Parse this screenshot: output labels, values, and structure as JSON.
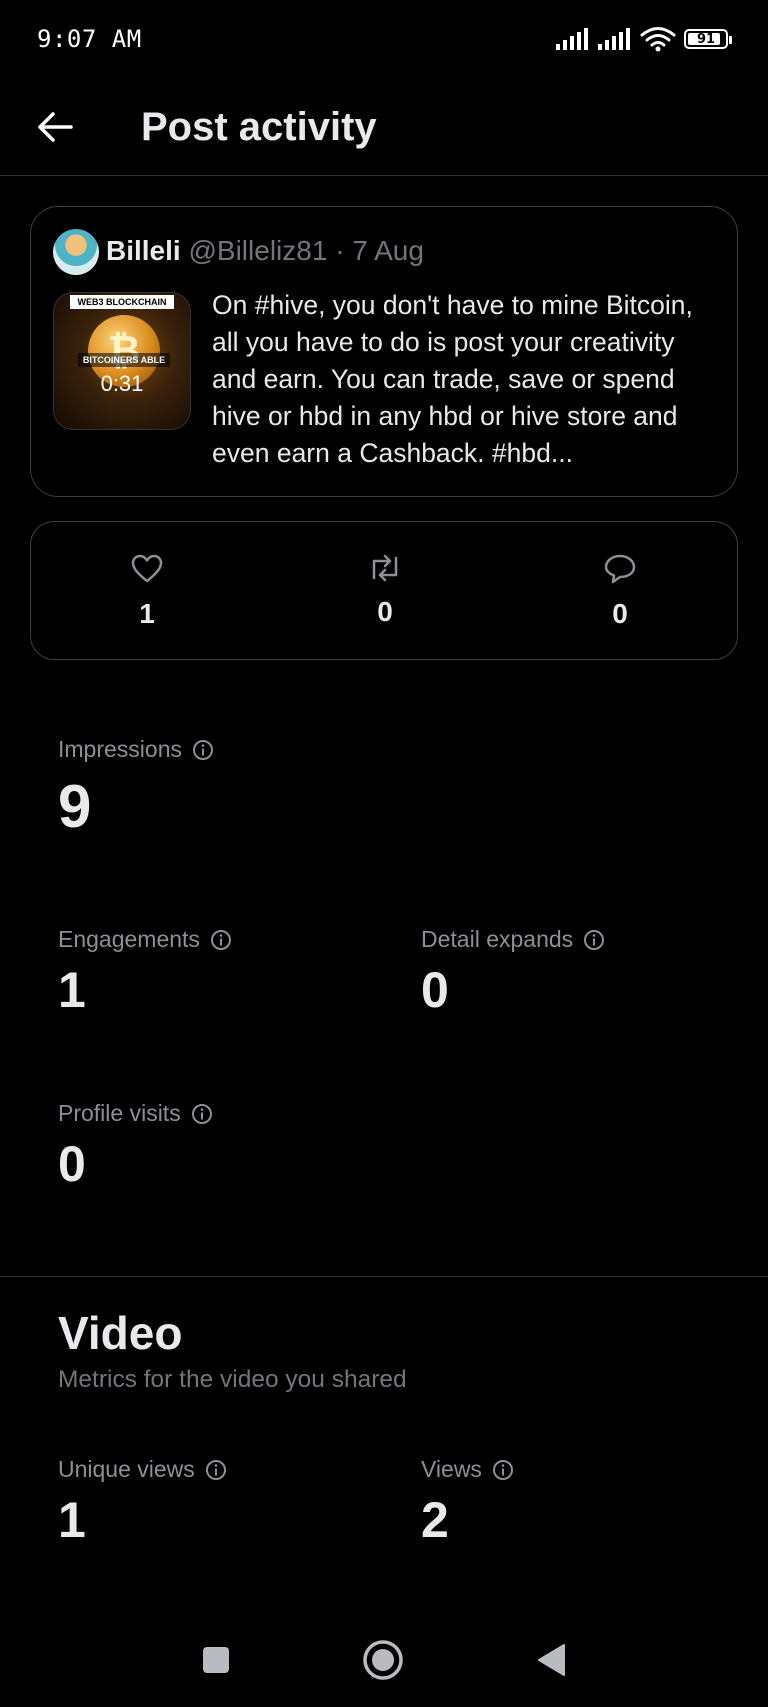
{
  "status": {
    "time": "9:07 AM",
    "battery": "91",
    "battery_level": 0.91,
    "icons": [
      "signal-icon",
      "signal-icon",
      "wifi-icon",
      "battery-icon"
    ]
  },
  "header": {
    "title": "Post activity",
    "back_icon": "arrow-left-icon"
  },
  "post": {
    "author_name": "Billeli",
    "author_handle": "@Billeliz81",
    "separator": "·",
    "date": "7 Aug",
    "thumbnail": {
      "banner": "WEB3 BLOCKCHAIN",
      "caption": "BITCOINERS ABLE",
      "duration": "0:31"
    },
    "text": "On #hive, you don't have to mine Bitcoin, all you have to do is  post your creativity and earn. You can trade, save or spend hive or hbd in any hbd or hive store and even earn a Cashback. #hbd..."
  },
  "stats": {
    "likes": "1",
    "reposts": "0",
    "replies": "0"
  },
  "metrics": {
    "impressions": {
      "label": "Impressions",
      "value": "9"
    },
    "engagements": {
      "label": "Engagements",
      "value": "1"
    },
    "detail_expands": {
      "label": "Detail expands",
      "value": "0"
    },
    "profile_visits": {
      "label": "Profile visits",
      "value": "0"
    }
  },
  "video": {
    "title": "Video",
    "subtitle": "Metrics for the video you shared",
    "unique_views": {
      "label": "Unique views",
      "value": "1"
    },
    "views": {
      "label": "Views",
      "value": "2"
    }
  },
  "colors": {
    "background": "#000000",
    "text_primary": "#e7e9ea",
    "text_secondary": "#71767b",
    "border": "#3a3f44"
  }
}
